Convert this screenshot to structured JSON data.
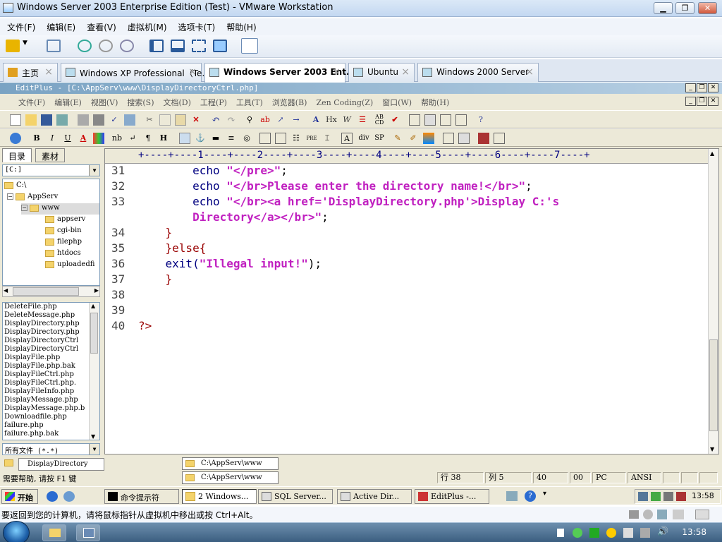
{
  "vm": {
    "title": "Windows Server 2003 Enterprise Edition (Test) - VMware Workstation",
    "menu": [
      "文件(F)",
      "编辑(E)",
      "查看(V)",
      "虚拟机(M)",
      "选项卡(T)",
      "帮助(H)"
    ],
    "tabs": [
      {
        "label": "主页"
      },
      {
        "label": "Windows XP Professional（Te..."
      },
      {
        "label": "Windows Server 2003 Ent..."
      },
      {
        "label": "Ubuntu"
      },
      {
        "label": "Windows 2000 Server"
      }
    ],
    "close_glyph": "×"
  },
  "editplus": {
    "title": "EditPlus - [C:\\AppServ\\www\\DisplayDirectoryCtrl.php]",
    "menu": [
      "文件(F)",
      "编辑(E)",
      "视图(V)",
      "搜索(S)",
      "文档(D)",
      "工程(P)",
      "工具(T)",
      "浏览器(B)",
      "Zen Coding(Z)",
      "窗口(W)",
      "帮助(H)"
    ],
    "left_tabs": [
      "目录",
      "素材"
    ],
    "drive_combo": "[C:]",
    "tree": [
      {
        "label": "C:\\"
      },
      {
        "label": "AppServ",
        "toggle": "−"
      },
      {
        "label": "www",
        "toggle": "−"
      },
      {
        "label": "appserv"
      },
      {
        "label": "cgi-bin"
      },
      {
        "label": "filephp"
      },
      {
        "label": "htdocs"
      },
      {
        "label": "uploadedfi"
      }
    ],
    "files": [
      "DeleteFile.php",
      "DeleteMessage.php",
      "DisplayDirectory.php",
      "DisplayDirectory.php",
      "DisplayDirectoryCtrl",
      "DisplayDirectoryCtrl",
      "DisplayFile.php",
      "DisplayFile.php.bak",
      "DisplayFileCtrl.php",
      "DisplayFileCtrl.php.",
      "DisplayFileInfo.php",
      "DisplayMessage.php",
      "DisplayMessage.php.b",
      "Downloadfile.php",
      "failure.php",
      "failure.php.bak"
    ],
    "filter_combo": "所有文件 (*.*)",
    "ruler": "+----+----1----+----2----+----3----+----4----+----5----+----6----+----7----+",
    "code": [
      {
        "n": "31",
        "a": "        echo ",
        "s": "\"</pre>\"",
        "e": ";"
      },
      {
        "n": "32",
        "a": "        echo ",
        "s": "\"</br>Please enter the directory name!</br>\"",
        "e": ";"
      },
      {
        "n": "33",
        "a": "        echo ",
        "s": "\"</br><a href='DisplayDirectory.php'>Display C:'s",
        "e": ""
      },
      {
        "n": "",
        "a": "        ",
        "s": "Directory</a></br>\"",
        "e": ";"
      },
      {
        "n": "34",
        "a": "    }",
        "s": "",
        "e": ""
      },
      {
        "n": "35",
        "a": "    }else{",
        "s": "",
        "e": ""
      },
      {
        "n": "36",
        "a": "    exit(",
        "s": "\"Illegal input!\"",
        "e": ");"
      },
      {
        "n": "37",
        "a": "    }",
        "s": "",
        "e": ""
      },
      {
        "n": "38",
        "a": "",
        "s": "",
        "e": ""
      },
      {
        "n": "39",
        "a": "",
        "s": "",
        "e": ""
      },
      {
        "n": "40",
        "a": "?>",
        "s": "",
        "e": ""
      }
    ],
    "doc_tab": "DisplayDirectory",
    "status": {
      "help": "需要帮助, 请按 F1 键",
      "row": "行 38",
      "col": "列 5",
      "c1": "40",
      "c2": "00",
      "c3": "PC",
      "c4": "ANSI"
    }
  },
  "guest_taskbar": {
    "start": "开始",
    "tasks": [
      "命令提示符",
      "2 Windows...",
      "SQL Server...",
      "Active Dir...",
      "EditPlus -..."
    ],
    "popups": [
      "C:\\AppServ\\www",
      "C:\\AppServ\\www"
    ],
    "clock": "13:58"
  },
  "host": {
    "message": "要返回到您的计算机，请将鼠标指针从虚拟机中移出或按 Ctrl+Alt。",
    "clock": "13:58"
  }
}
